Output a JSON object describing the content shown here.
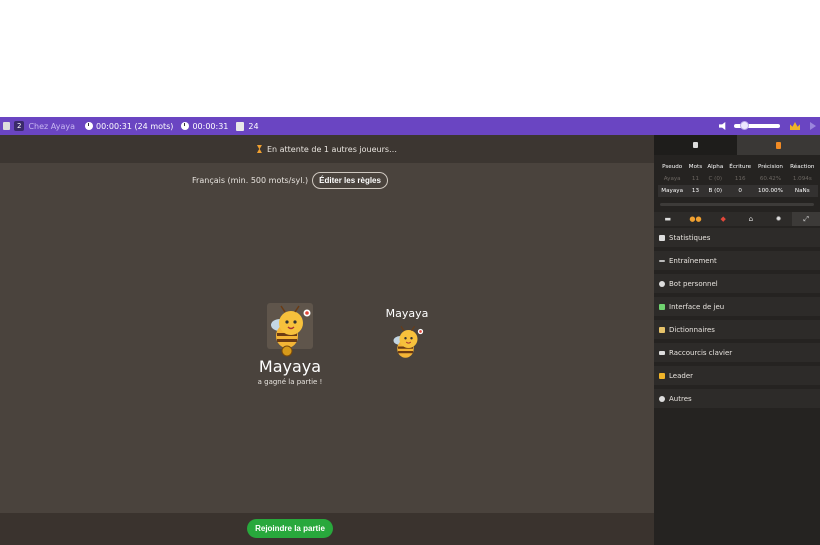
{
  "topbar": {
    "player_count": "2",
    "room_name": "Chez Ayaya",
    "timer_round": "00:00:31 (24 mots)",
    "timer_total": "00:00:31",
    "words_count": "24",
    "accent_color": "#6a45c2"
  },
  "game": {
    "waiting_text": "En attente de 1 autres joueurs…",
    "rules_text": "Français (min. 500 mots/syl.)",
    "edit_rules_label": "Éditer les règles",
    "winner_name": "Mayaya",
    "winner_subtitle": "a gagné la partie !",
    "player2_name": "Mayaya",
    "join_label": "Rejoindre la partie",
    "join_color": "#28a83c"
  },
  "sidebar": {
    "table": {
      "headers": [
        "Pseudo",
        "Mots",
        "Alpha",
        "Écriture",
        "Précision",
        "Réaction"
      ],
      "rows": [
        [
          "Ayaya",
          "11",
          "C (0)",
          "116",
          "60.42%",
          "1.094s"
        ],
        [
          "Mayaya",
          "13",
          "B (0)",
          "0",
          "100.00%",
          "NaNs"
        ]
      ]
    },
    "icon_tabs": [
      "chat-icon",
      "players-icon",
      "game-icon",
      "home-icon",
      "settings-icon",
      "expand-icon"
    ],
    "menu": [
      {
        "label": "Statistiques",
        "icon": "stats-icon",
        "color": "#dddddd"
      },
      {
        "label": "Entraînement",
        "icon": "pencil-icon",
        "color": "#dddddd"
      },
      {
        "label": "Bot personnel",
        "icon": "robot-icon",
        "color": "#dddddd"
      },
      {
        "label": "Interface de jeu",
        "icon": "tools-icon",
        "color": "#6fd36f"
      },
      {
        "label": "Dictionnaires",
        "icon": "book-icon",
        "color": "#e6c36a"
      },
      {
        "label": "Raccourcis clavier",
        "icon": "keyboard-icon",
        "color": "#dddddd"
      },
      {
        "label": "Leader",
        "icon": "crown-icon",
        "color": "#f0b429"
      },
      {
        "label": "Autres",
        "icon": "gear-icon",
        "color": "#dddddd"
      }
    ]
  }
}
